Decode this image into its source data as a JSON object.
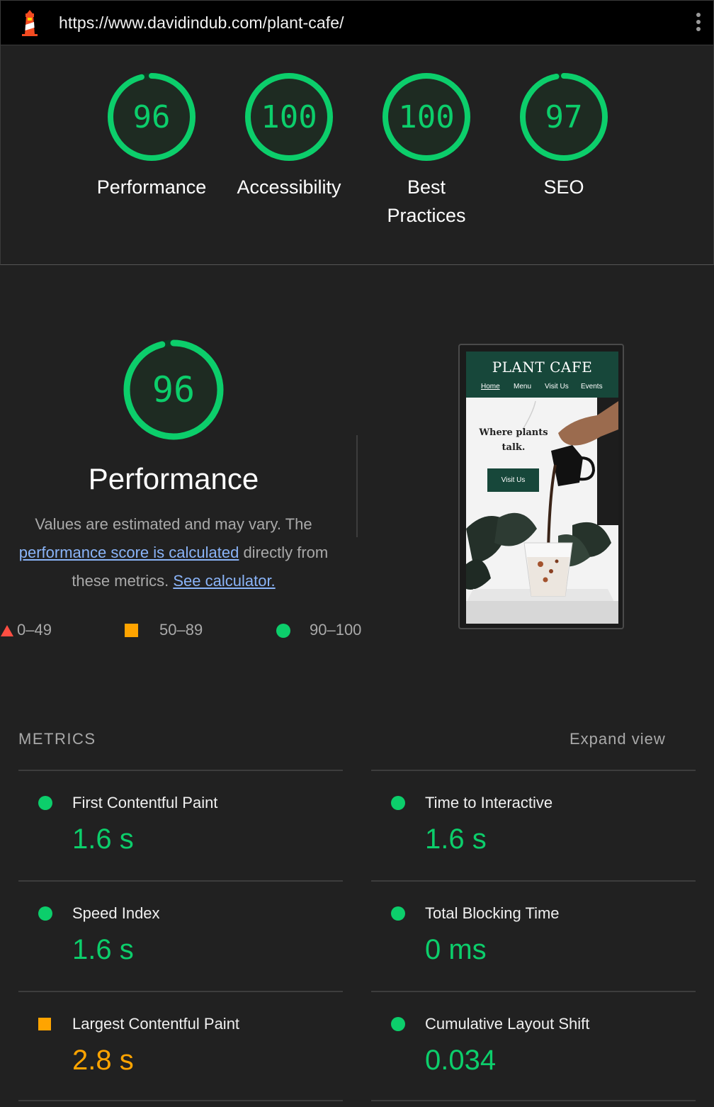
{
  "topbar": {
    "url": "https://www.davidindub.com/plant-cafe/"
  },
  "colors": {
    "pass": "#0cce6b",
    "average": "#ffa400",
    "background": "#212121"
  },
  "categories": [
    {
      "label": "Performance",
      "score": 96
    },
    {
      "label": "Accessibility",
      "score": 100
    },
    {
      "label": "Best Practices",
      "score": 100
    },
    {
      "label": "SEO",
      "score": 97
    }
  ],
  "performance": {
    "score": 96,
    "title": "Performance",
    "desc_before": "Values are estimated and may vary. The ",
    "desc_link": "performance score is calculated",
    "desc_after": " directly from these metrics. ",
    "calc_link": "See calculator."
  },
  "legend": {
    "fail": "0–49",
    "average": "50–89",
    "pass": "90–100"
  },
  "screenshot": {
    "title": "PLANT CAFE",
    "nav": [
      "Home",
      "Menu",
      "Visit Us",
      "Events"
    ],
    "tagline": "Where plants talk.",
    "button": "Visit Us"
  },
  "metrics": {
    "heading": "METRICS",
    "expand": "Expand view",
    "items": [
      {
        "label": "First Contentful Paint",
        "value": "1.6 s",
        "status": "pass"
      },
      {
        "label": "Time to Interactive",
        "value": "1.6 s",
        "status": "pass"
      },
      {
        "label": "Speed Index",
        "value": "1.6 s",
        "status": "pass"
      },
      {
        "label": "Total Blocking Time",
        "value": "0 ms",
        "status": "pass"
      },
      {
        "label": "Largest Contentful Paint",
        "value": "2.8 s",
        "status": "average"
      },
      {
        "label": "Cumulative Layout Shift",
        "value": "0.034",
        "status": "pass"
      }
    ]
  }
}
